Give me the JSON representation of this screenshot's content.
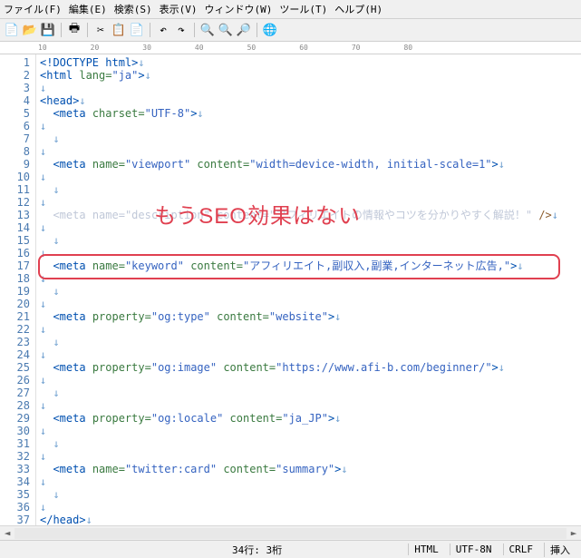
{
  "menu": {
    "file": "ファイル(F)",
    "edit": "編集(E)",
    "search": "検索(S)",
    "view": "表示(V)",
    "window": "ウィンドウ(W)",
    "tool": "ツール(T)",
    "help": "ヘルプ(H)"
  },
  "ruler": [
    "10",
    "20",
    "30",
    "40",
    "50",
    "60",
    "70",
    "80"
  ],
  "lines": {
    "count": 38
  },
  "code": {
    "l1": "<!DOCTYPE html>",
    "l2_open": "<html ",
    "l2_attr": "lang=",
    "l2_val": "\"ja\"",
    "l2_close": ">",
    "l4": "<head>",
    "l5_open": "<meta ",
    "l5_attr": "charset=",
    "l5_val": "\"UTF-8\"",
    "l5_close": ">",
    "l9_open": "<meta ",
    "l9_attr1": "name=",
    "l9_val1": "\"viewport\"",
    "l9_attr2": " content=",
    "l9_val2": "\"width=device-width, initial-scale=1\"",
    "l9_close": ">",
    "l13_open": "<meta ",
    "l13_attr1": "name=",
    "l13_val1": "\"description\"",
    "l13_attr2": " content=",
    "l13_val2": "\"アフィリエイトの情報やコツを分かりやすく解説！\"",
    "l13_close": " />",
    "l17_open": "<meta ",
    "l17_attr1": "name=",
    "l17_val1": "\"keyword\"",
    "l17_attr2": " content=",
    "l17_val2": "\"アフィリエイト,副収入,副業,インターネット広告,\"",
    "l17_close": ">",
    "l21_open": "<meta ",
    "l21_attr1": "property=",
    "l21_val1": "\"og:type\"",
    "l21_attr2": " content=",
    "l21_val2": "\"website\"",
    "l21_close": ">",
    "l25_open": "<meta ",
    "l25_attr1": "property=",
    "l25_val1": "\"og:image\"",
    "l25_attr2": " content=",
    "l25_val2": "\"https://www.afi-b.com/beginner/\"",
    "l25_close": ">",
    "l29_open": "<meta ",
    "l29_attr1": "property=",
    "l29_val1": "\"og:locale\"",
    "l29_attr2": " content=",
    "l29_val2": "\"ja_JP\"",
    "l29_close": ">",
    "l33_open": "<meta ",
    "l33_attr1": "name=",
    "l33_val1": "\"twitter:card\"",
    "l33_attr2": " content=",
    "l33_val2": "\"summary\"",
    "l33_close": ">",
    "l37": "</head>"
  },
  "annotation": "もうSEO効果はない",
  "status": {
    "pos": "34行: 3桁",
    "mode": "HTML",
    "enc": "UTF-8N",
    "eol": "CRLF",
    "ins": "挿入"
  }
}
